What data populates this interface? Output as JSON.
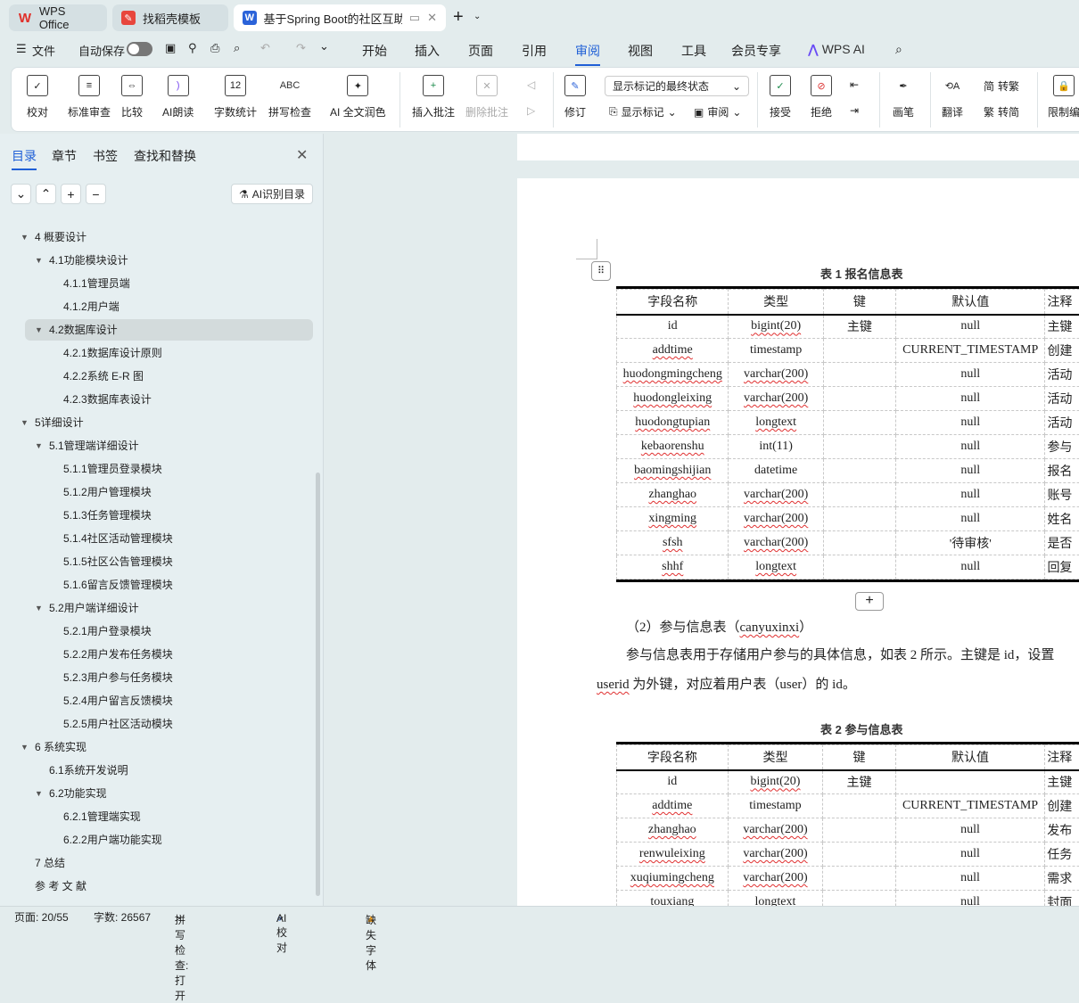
{
  "tabs": [
    {
      "label": "WPS Office",
      "icon": "wps-logo"
    },
    {
      "label": "找稻壳模板",
      "icon": "docer-logo"
    },
    {
      "label": "基于Spring Boot的社区互助",
      "icon": "writer-logo"
    }
  ],
  "menu": {
    "file": "文件",
    "autosave": "自动保存",
    "items": [
      "开始",
      "插入",
      "页面",
      "引用",
      "审阅",
      "视图",
      "工具",
      "会员专享"
    ],
    "active": "审阅",
    "wps_ai": "WPS AI"
  },
  "ribbon": {
    "buttons": [
      "校对",
      "标准审查",
      "比较",
      "AI朗读",
      "字数统计",
      "拼写检查",
      "AI 全文润色",
      "插入批注",
      "删除批注",
      "修订",
      "画笔",
      "翻译",
      "限制编"
    ],
    "icon_text": {
      "wordcount": "12",
      "spell": "ABC"
    },
    "markup_select": "显示标记的最终状态",
    "show_markup": "显示标记",
    "review": "审阅",
    "accept": "接受",
    "reject": "拒绝",
    "to_trad": "转繁",
    "to_simp": "转简"
  },
  "sidebar": {
    "tabs": [
      "目录",
      "章节",
      "书签",
      "查找和替换"
    ],
    "ai_button": "AI识别目录",
    "toc": [
      {
        "label": "4  概要设计",
        "level": 1,
        "exp": true
      },
      {
        "label": "4.1功能模块设计",
        "level": 2,
        "exp": true
      },
      {
        "label": "4.1.1管理员端",
        "level": 3
      },
      {
        "label": "4.1.2用户端",
        "level": 3
      },
      {
        "label": "4.2数据库设计",
        "level": 2,
        "exp": true,
        "selected": true
      },
      {
        "label": "4.2.1数据库设计原则",
        "level": 3
      },
      {
        "label": "4.2.2系统 E-R 图",
        "level": 3
      },
      {
        "label": "4.2.3数据库表设计",
        "level": 3
      },
      {
        "label": "5详细设计",
        "level": 1,
        "exp": true
      },
      {
        "label": "5.1管理端详细设计",
        "level": 2,
        "exp": true
      },
      {
        "label": "5.1.1管理员登录模块",
        "level": 3
      },
      {
        "label": "5.1.2用户管理模块",
        "level": 3
      },
      {
        "label": "5.1.3任务管理模块",
        "level": 3
      },
      {
        "label": "5.1.4社区活动管理模块",
        "level": 3
      },
      {
        "label": "5.1.5社区公告管理模块",
        "level": 3
      },
      {
        "label": "5.1.6留言反馈管理模块",
        "level": 3
      },
      {
        "label": "5.2用户端详细设计",
        "level": 2,
        "exp": true
      },
      {
        "label": "5.2.1用户登录模块",
        "level": 3
      },
      {
        "label": "5.2.2用户发布任务模块",
        "level": 3
      },
      {
        "label": "5.2.3用户参与任务模块",
        "level": 3
      },
      {
        "label": "5.2.4用户留言反馈模块",
        "level": 3
      },
      {
        "label": "5.2.5用户社区活动模块",
        "level": 3
      },
      {
        "label": "6  系统实现",
        "level": 1,
        "exp": true
      },
      {
        "label": "6.1系统开发说明",
        "level": 2
      },
      {
        "label": "6.2功能实现",
        "level": 2,
        "exp": true
      },
      {
        "label": "6.2.1管理端实现",
        "level": 3
      },
      {
        "label": "6.2.2用户端功能实现",
        "level": 3
      },
      {
        "label": "7  总结",
        "level": 1
      },
      {
        "label": "参  考  文  献",
        "level": 1
      }
    ]
  },
  "document": {
    "table1": {
      "caption": "表 1  报名信息表",
      "headers": [
        "字段名称",
        "类型",
        "键",
        "默认值",
        "注释"
      ],
      "rows": [
        [
          "id",
          "bigint(20)",
          "主键",
          "null",
          "主键"
        ],
        [
          "addtime",
          "timestamp",
          "",
          "CURRENT_TIMESTAMP",
          "创建"
        ],
        [
          "huodongmingcheng",
          "varchar(200)",
          "",
          "null",
          "活动"
        ],
        [
          "huodongleixing",
          "varchar(200)",
          "",
          "null",
          "活动"
        ],
        [
          "huodongtupian",
          "longtext",
          "",
          "null",
          "活动"
        ],
        [
          "kebaorenshu",
          "int(11)",
          "",
          "null",
          "参与"
        ],
        [
          "baomingshijian",
          "datetime",
          "",
          "null",
          "报名"
        ],
        [
          "zhanghao",
          "varchar(200)",
          "",
          "null",
          "账号"
        ],
        [
          "xingming",
          "varchar(200)",
          "",
          "null",
          "姓名"
        ],
        [
          "sfsh",
          "varchar(200)",
          "",
          "'待审核'",
          "是否"
        ],
        [
          "shhf",
          "longtext",
          "",
          "null",
          "回复"
        ]
      ]
    },
    "section_heading": "（2）参与信息表（",
    "section_heading_code": "canyuxinxi",
    "section_heading_end": "）",
    "para_line1": "参与信息表用于存储用户参与的具体信息，如表 2 所示。主键是 id，设置",
    "para_line2_code": "userid",
    "para_line2": " 为外键，对应着用户表（user）的 id。",
    "table2": {
      "caption": "表 2  参与信息表",
      "headers": [
        "字段名称",
        "类型",
        "键",
        "默认值",
        "注释"
      ],
      "rows": [
        [
          "id",
          "bigint(20)",
          "主键",
          "",
          "主键"
        ],
        [
          "addtime",
          "timestamp",
          "",
          "CURRENT_TIMESTAMP",
          "创建"
        ],
        [
          "zhanghao",
          "varchar(200)",
          "",
          "null",
          "发布"
        ],
        [
          "renwuleixing",
          "varchar(200)",
          "",
          "null",
          "任务"
        ],
        [
          "xuqiumingcheng",
          "varchar(200)",
          "",
          "null",
          "需求"
        ],
        [
          "touxiang",
          "longtext",
          "",
          "null",
          "封面"
        ]
      ]
    }
  },
  "status": {
    "page": "页面: 20/55",
    "words": "字数: 26567",
    "spell": "拼写检查: 打开",
    "ai_check": "AI 校对",
    "missing_font": "缺失字体"
  }
}
